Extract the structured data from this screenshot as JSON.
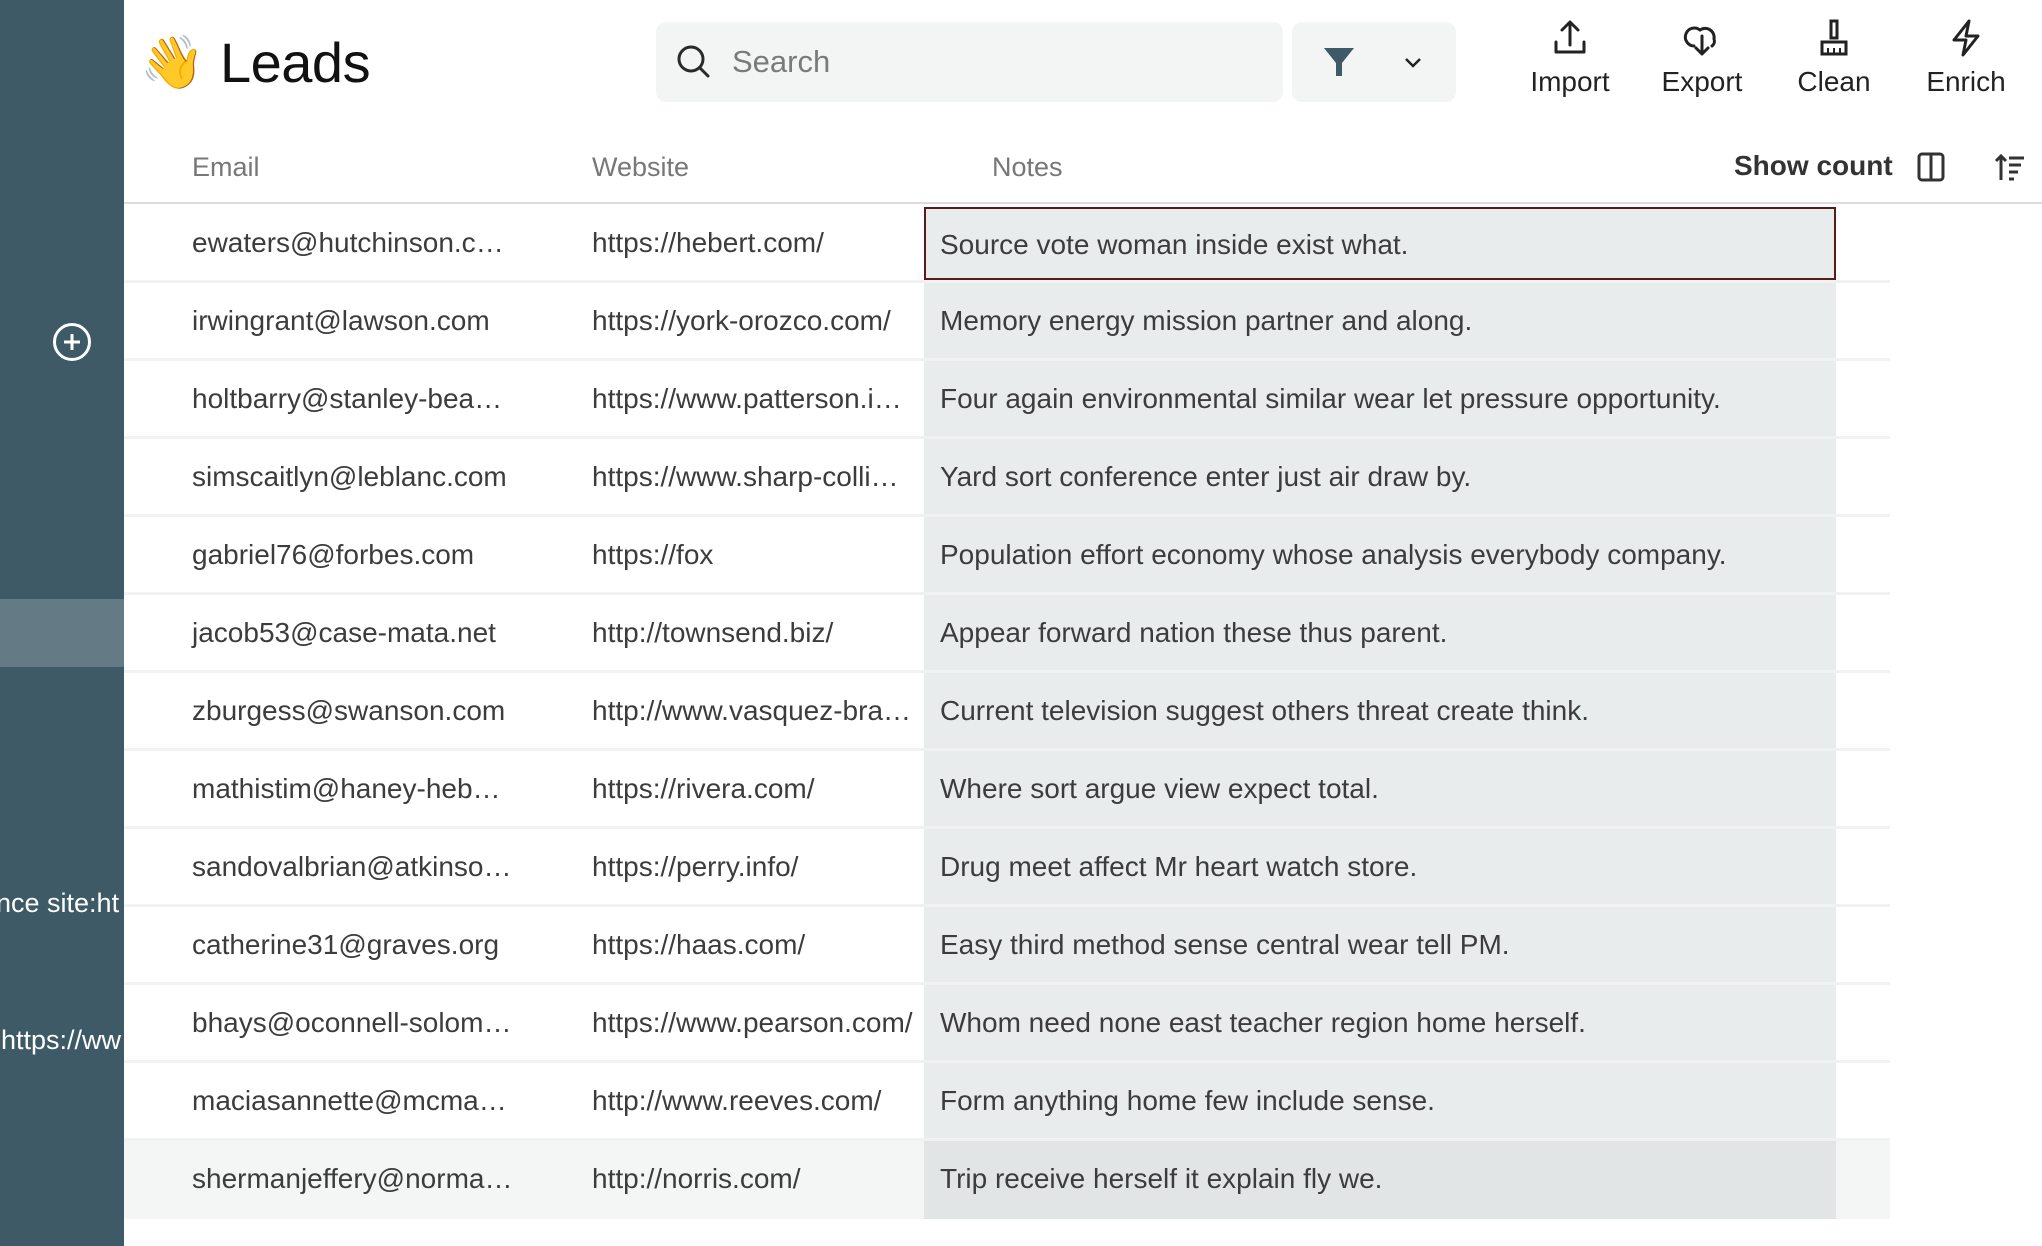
{
  "sidebar": {
    "add_icon": "plus-circle-icon",
    "overflow_text_1": "nce site:ht",
    "overflow_text_2": "https://ww"
  },
  "header": {
    "emoji": "👋",
    "title": "Leads",
    "search": {
      "placeholder": "Search",
      "value": "",
      "icon": "search-icon"
    },
    "filter": {
      "icon": "funnel-icon",
      "dropdown_icon": "chevron-down-icon"
    },
    "tools": [
      {
        "label": "Import",
        "icon": "upload-icon"
      },
      {
        "label": "Export",
        "icon": "cloud-download-icon"
      },
      {
        "label": "Clean",
        "icon": "broom-icon"
      },
      {
        "label": "Enrich",
        "icon": "lightning-icon"
      }
    ]
  },
  "table": {
    "columns": [
      "Email",
      "Website",
      "Notes"
    ],
    "show_count_label": "Show count",
    "column_toggle_icon": "columns-icon",
    "sort_icon": "sort-ascending-icon",
    "rows": [
      {
        "email": "ewaters@hutchinson.com",
        "website": "https://hebert.com/",
        "notes": "Source vote woman inside exist what."
      },
      {
        "email": "irwingrant@lawson.com",
        "website": "https://york-orozco.com/",
        "notes": "Memory energy mission partner and along."
      },
      {
        "email": "holtbarry@stanley-beasley.c…",
        "website": "https://www.patterson.info/",
        "notes": "Four again environmental similar wear let pressure opportunity."
      },
      {
        "email": "simscaitlyn@leblanc.com",
        "website": "https://www.sharp-collier.or…",
        "notes": "Yard sort conference enter just air draw by."
      },
      {
        "email": "gabriel76@forbes.com",
        "website": "https://fox",
        "notes": "Population effort economy whose analysis everybody company."
      },
      {
        "email": "jacob53@case-mata.net",
        "website": "http://townsend.biz/",
        "notes": "Appear forward nation these thus parent."
      },
      {
        "email": "zburgess@swanson.com",
        "website": "http://www.vasquez-bradley…",
        "notes": "Current television suggest others threat create think."
      },
      {
        "email": "mathistim@haney-hebert.c…",
        "website": "https://rivera.com/",
        "notes": "Where sort argue view expect total."
      },
      {
        "email": "sandovalbrian@atkinson.org",
        "website": "https://perry.info/",
        "notes": "Drug meet affect Mr heart watch store."
      },
      {
        "email": "catherine31@graves.org",
        "website": "https://haas.com/",
        "notes": "Easy third method sense central wear tell PM."
      },
      {
        "email": "bhays@oconnell-solomon.c…",
        "website": "https://www.pearson.com/",
        "notes": "Whom need none east teacher region home herself."
      },
      {
        "email": "maciasannette@mcmahon.…",
        "website": "http://www.reeves.com/",
        "notes": "Form anything home few include sense."
      },
      {
        "email": "shermanjeffery@norman-m…",
        "website": "http://norris.com/",
        "notes": "Trip receive herself it explain fly we."
      }
    ]
  },
  "colors": {
    "sidebar": "#3d5a66",
    "sidebar_active": "#647b85",
    "selection_border": "#5a1a1a",
    "notes_bg": "#e8eced",
    "accent_icon": "#3d5a66"
  }
}
